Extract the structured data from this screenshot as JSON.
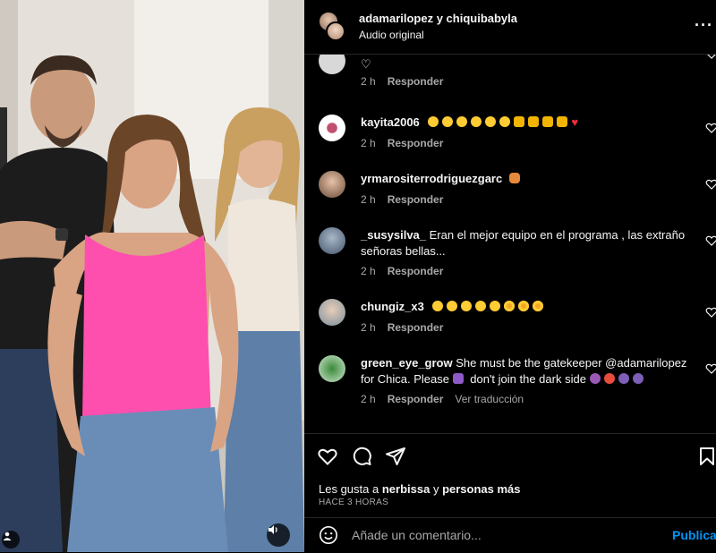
{
  "post": {
    "authors": "adamarilopez y chiquibabyla",
    "audio": "Audio original",
    "more_icon": "more-options-icon"
  },
  "comments": [
    {
      "username": "",
      "text": "",
      "time": "2 h",
      "reply": "Responder",
      "emojis": [
        "white-heart"
      ]
    },
    {
      "username": "kayita2006",
      "text": "",
      "time": "2 h",
      "reply": "Responder",
      "emojis": [
        "grin",
        "grin",
        "grin",
        "grin",
        "grin",
        "grin",
        "clap",
        "clap",
        "clap",
        "clap",
        "red-heart"
      ]
    },
    {
      "username": "yrmarositerrodriguezgarc",
      "text": "",
      "time": "2 h",
      "reply": "Responder",
      "emojis": [
        "pray"
      ]
    },
    {
      "username": "_susysilva_",
      "text": "Eran el mejor equipo en el programa , las extraño señoras bellas...",
      "time": "2 h",
      "reply": "Responder"
    },
    {
      "username": "chungiz_x3",
      "text": "",
      "time": "2 h",
      "reply": "Responder",
      "emojis": [
        "grin",
        "grin",
        "grin",
        "grin",
        "grin",
        "heart-eyes",
        "heart-eyes",
        "heart-eyes"
      ]
    },
    {
      "username": "green_eye_grow",
      "text": "She must be the gatekeeper @adamarilopez for Chica. Please",
      "text2": "don't join the dark side",
      "time": "2 h",
      "reply": "Responder",
      "translate": "Ver traducción"
    }
  ],
  "likes": {
    "prefix": "Les gusta a",
    "user": "nerbissa",
    "suffix": "y",
    "others": "personas más"
  },
  "timestamp": "HACE 3 HORAS",
  "composer": {
    "placeholder": "Añade un comentario...",
    "publish": "Publicar"
  },
  "colors": {
    "background": "#000000",
    "text": "#f5f5f5",
    "secondary": "#a8a8a8",
    "link": "#0095f6",
    "divider": "#262626",
    "pink_top": "#ff4fae"
  }
}
